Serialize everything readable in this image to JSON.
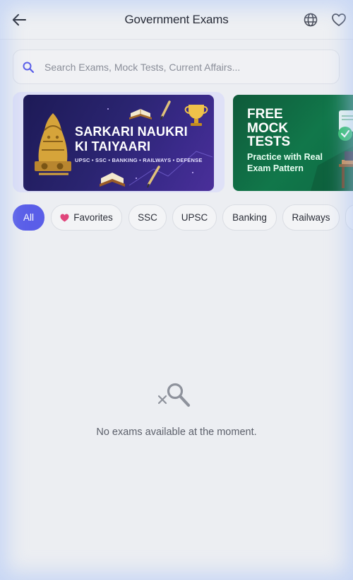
{
  "header": {
    "title": "Government Exams",
    "back_icon": "arrow-left-icon",
    "language_icon": "globe-icon",
    "favorites_icon": "heart-icon"
  },
  "search": {
    "placeholder": "Search Exams, Mock Tests, Current Affairs...",
    "value": "",
    "icon": "search-icon",
    "accent_color": "#5a5ee8"
  },
  "banners": [
    {
      "title_line1": "SARKARI NAUKRI",
      "title_line2": "KI TAIYAARI",
      "subtitle": "UPSC • SSC • BANKING • RAILWAYS • DEFENSE"
    },
    {
      "title_line1": "FREE",
      "title_line2": "MOCK",
      "title_line3": "TESTS",
      "subtitle": "Practice with Real Exam Pattern"
    }
  ],
  "filters": {
    "items": [
      {
        "label": "All",
        "active": true
      },
      {
        "label": "Favorites",
        "active": false,
        "icon": "heart-icon"
      },
      {
        "label": "SSC",
        "active": false
      },
      {
        "label": "UPSC",
        "active": false
      },
      {
        "label": "Banking",
        "active": false
      },
      {
        "label": "Railways",
        "active": false
      }
    ],
    "active_color": "#5a5ee8",
    "favorite_icon_color": "#e0457b"
  },
  "empty_state": {
    "icon": "search-off-icon",
    "message": "No exams available at the moment."
  }
}
